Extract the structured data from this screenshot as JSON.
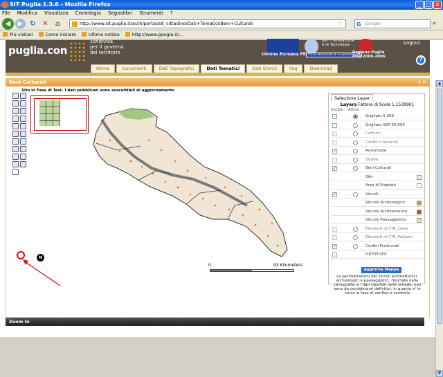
{
  "window": {
    "title": "SIT Puglia 1.3.6 - Mozilla Firefox"
  },
  "menu": [
    "File",
    "Modifica",
    "Visualizza",
    "Cronologia",
    "Segnalibri",
    "Strumenti",
    "?"
  ],
  "nav": {
    "url": "http://www.sit.puglia.it/auth/portal/sit_cittadino/Dati+Tematici/Beni+Culturali",
    "search_placeholder": "Google",
    "search_engine_glyph": "G"
  },
  "bookmarks": [
    "Più visitati",
    "Come iniziare",
    "Ultime notizie",
    "http://www.google.it/..."
  ],
  "site": {
    "logo": "puglia.con",
    "tagline": [
      "condivisa",
      "per il governo",
      "del territorio"
    ],
    "eu_label": "Unione Europea FESR",
    "inno_label": [
      "per l'Innovazione",
      "e le Tecnologie"
    ],
    "gov_label": "Piano Nazionale di e-Government",
    "region_label": [
      "Regione Puglia",
      "POR 2000-2006"
    ],
    "logout": "Logout",
    "help_glyph": "?"
  },
  "tabs": [
    "Home",
    "Documenti",
    "Dati Topografici",
    "Dati Tematici",
    "Dati Storici",
    "Faq",
    "Download"
  ],
  "active_tab": "Dati Tematici",
  "panel": {
    "title": "Beni Culturali",
    "map_title": "Sito in Fase di Test. I dati pubblicati sono suscettibili di aggiornamento",
    "scale_start": "0",
    "scale_end": "93 Kilometers",
    "north_glyph": "N",
    "zoom_status": "Zoom In"
  },
  "layers": {
    "tab": "Selezione Layer",
    "heading": "Layers",
    "scale_factor": "Fattore di Scale 1:1539901",
    "col_visible": "Visible",
    "col_active": "Attivo",
    "rows": [
      {
        "name": "Grigliato 5.000",
        "check": "off",
        "radio": "on",
        "dim": false,
        "swatch": ""
      },
      {
        "name": "Grigliato IGM 50.000",
        "check": "off",
        "radio": "off",
        "dim": false,
        "swatch": ""
      },
      {
        "name": "Comuni",
        "check": "dis",
        "radio": "off",
        "dim": true,
        "swatch": ""
      },
      {
        "name": "Confini Comunali",
        "check": "dis",
        "radio": "off",
        "dim": true,
        "swatch": ""
      },
      {
        "name": "Autostrade",
        "check": "on",
        "radio": "off",
        "dim": false,
        "swatch": ""
      },
      {
        "name": "Strade",
        "check": "dis",
        "radio": "off",
        "dim": true,
        "swatch": ""
      },
      {
        "name": "Beni Culturali",
        "check": "on",
        "radio": "off",
        "dim": false,
        "swatch": ""
      },
      {
        "name": "Sito",
        "check": "none",
        "radio": "none",
        "dim": false,
        "swatch": "#fbe8dc"
      },
      {
        "name": "Area di Rispetto",
        "check": "none",
        "radio": "none",
        "dim": false,
        "swatch": "#ffffff"
      },
      {
        "name": "Vincoli",
        "check": "on",
        "radio": "off",
        "dim": false,
        "swatch": ""
      },
      {
        "name": "Vincolo Archeologico",
        "check": "none",
        "radio": "none",
        "dim": false,
        "swatch": "#c9a43a"
      },
      {
        "name": "Vincolo Architettonico",
        "check": "none",
        "radio": "none",
        "dim": false,
        "swatch": "#b25a1d"
      },
      {
        "name": "Vincolo Paesaggistico",
        "check": "none",
        "radio": "none",
        "dim": false,
        "swatch": "#d6e9a0"
      },
      {
        "name": "Elementi di CTR_Linee",
        "check": "dis",
        "radio": "off",
        "dim": true,
        "swatch": ""
      },
      {
        "name": "Elementi di CTR_Poligoni",
        "check": "dis",
        "radio": "off",
        "dim": true,
        "swatch": ""
      },
      {
        "name": "Confini Provinciali",
        "check": "on",
        "radio": "off",
        "dim": false,
        "swatch": ""
      },
      {
        "name": "ORTOFOTO",
        "check": "off",
        "radio": "none",
        "dim": false,
        "swatch": ""
      }
    ],
    "update_button": "Aggiorna Mappa",
    "note": "Le perimetrazioni dei vincoli architettonici, archeologici e paesaggistici, riportate nella cartografia, e i dati riportati nelle schede, non sono da considerarsi definitivi, in quanto e' in corso la fase di verifica e controllo"
  }
}
